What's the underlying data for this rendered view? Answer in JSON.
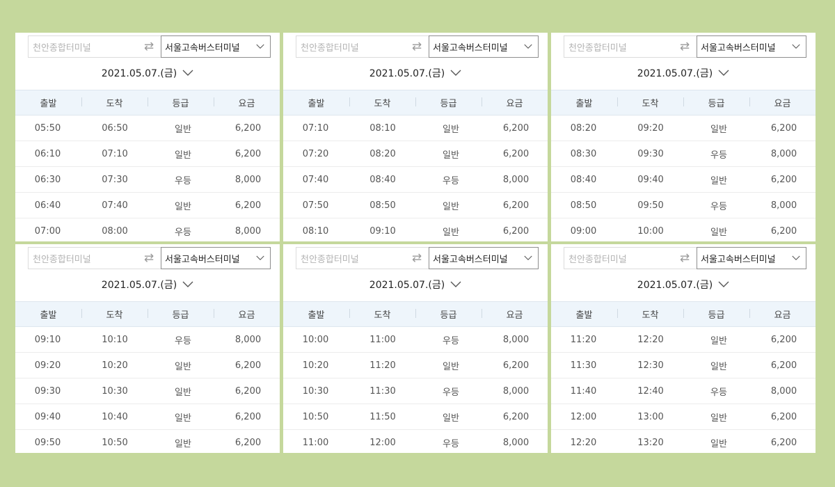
{
  "panels": [
    {
      "origin_placeholder": "천안종합터미널",
      "destination": "서울고속버스터미널",
      "date": "2021.05.07.(금)",
      "headers": [
        "출발",
        "도착",
        "등급",
        "요금"
      ],
      "rows": [
        [
          "05:50",
          "06:50",
          "일반",
          "6,200"
        ],
        [
          "06:10",
          "07:10",
          "일반",
          "6,200"
        ],
        [
          "06:30",
          "07:30",
          "우등",
          "8,000"
        ],
        [
          "06:40",
          "07:40",
          "일반",
          "6,200"
        ],
        [
          "07:00",
          "08:00",
          "우등",
          "8,000"
        ]
      ]
    },
    {
      "origin_placeholder": "천안종합터미널",
      "destination": "서울고속버스터미널",
      "date": "2021.05.07.(금)",
      "headers": [
        "출발",
        "도착",
        "등급",
        "요금"
      ],
      "rows": [
        [
          "07:10",
          "08:10",
          "일반",
          "6,200"
        ],
        [
          "07:20",
          "08:20",
          "일반",
          "6,200"
        ],
        [
          "07:40",
          "08:40",
          "우등",
          "8,000"
        ],
        [
          "07:50",
          "08:50",
          "일반",
          "6,200"
        ],
        [
          "08:10",
          "09:10",
          "일반",
          "6,200"
        ]
      ]
    },
    {
      "origin_placeholder": "천안종합터미널",
      "destination": "서울고속버스터미널",
      "date": "2021.05.07.(금)",
      "headers": [
        "출발",
        "도착",
        "등급",
        "요금"
      ],
      "rows": [
        [
          "08:20",
          "09:20",
          "일반",
          "6,200"
        ],
        [
          "08:30",
          "09:30",
          "우등",
          "8,000"
        ],
        [
          "08:40",
          "09:40",
          "일반",
          "6,200"
        ],
        [
          "08:50",
          "09:50",
          "우등",
          "8,000"
        ],
        [
          "09:00",
          "10:00",
          "일반",
          "6,200"
        ]
      ]
    },
    {
      "origin_placeholder": "천안종합터미널",
      "destination": "서울고속버스터미널",
      "date": "2021.05.07.(금)",
      "headers": [
        "출발",
        "도착",
        "등급",
        "요금"
      ],
      "rows": [
        [
          "09:10",
          "10:10",
          "우등",
          "8,000"
        ],
        [
          "09:20",
          "10:20",
          "일반",
          "6,200"
        ],
        [
          "09:30",
          "10:30",
          "일반",
          "6,200"
        ],
        [
          "09:40",
          "10:40",
          "일반",
          "6,200"
        ],
        [
          "09:50",
          "10:50",
          "일반",
          "6,200"
        ]
      ]
    },
    {
      "origin_placeholder": "천안종합터미널",
      "destination": "서울고속버스터미널",
      "date": "2021.05.07.(금)",
      "headers": [
        "출발",
        "도착",
        "등급",
        "요금"
      ],
      "rows": [
        [
          "10:00",
          "11:00",
          "우등",
          "8,000"
        ],
        [
          "10:20",
          "11:20",
          "일반",
          "6,200"
        ],
        [
          "10:30",
          "11:30",
          "우등",
          "8,000"
        ],
        [
          "10:50",
          "11:50",
          "일반",
          "6,200"
        ],
        [
          "11:00",
          "12:00",
          "우등",
          "8,000"
        ]
      ]
    },
    {
      "origin_placeholder": "천안종합터미널",
      "destination": "서울고속버스터미널",
      "date": "2021.05.07.(금)",
      "headers": [
        "출발",
        "도착",
        "등급",
        "요금"
      ],
      "rows": [
        [
          "11:20",
          "12:20",
          "일반",
          "6,200"
        ],
        [
          "11:30",
          "12:30",
          "일반",
          "6,200"
        ],
        [
          "11:40",
          "12:40",
          "우등",
          "8,000"
        ],
        [
          "12:00",
          "13:00",
          "일반",
          "6,200"
        ],
        [
          "12:20",
          "13:20",
          "일반",
          "6,200"
        ]
      ]
    }
  ],
  "icons": {
    "swap": "swap-arrows-icon",
    "dropdown": "chevron-down-icon"
  },
  "colors": {
    "background": "#c5d89c",
    "table_header": "#eef5fb"
  }
}
